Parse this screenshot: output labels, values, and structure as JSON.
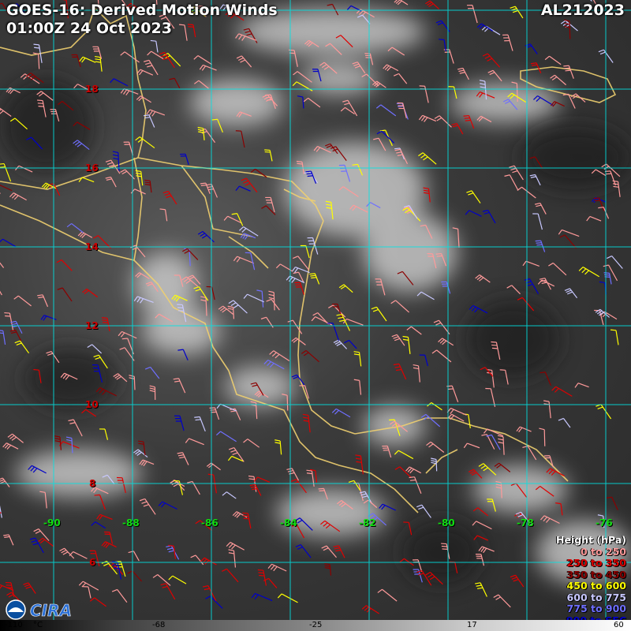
{
  "header": {
    "title_line1": "GOES-16: Derived Motion Winds",
    "title_line2": "01:00Z 24 Oct 2023",
    "storm_id": "AL212023"
  },
  "latitude_labels": [
    "18",
    "16",
    "14",
    "12",
    "10",
    "8",
    "6"
  ],
  "longitude_labels": [
    "-90",
    "-88",
    "-86",
    "-84",
    "-82",
    "-80",
    "-78",
    "-76"
  ],
  "legend": {
    "title": "Height (hPa)",
    "items": [
      {
        "label": "0 to 250",
        "color": "#ff9a9a"
      },
      {
        "label": "250 to 350",
        "color": "#e00000"
      },
      {
        "label": "350 to 450",
        "color": "#8b0000"
      },
      {
        "label": "450 to 600",
        "color": "#ffff00"
      },
      {
        "label": "600 to 775",
        "color": "#c8c8ff"
      },
      {
        "label": "775 to 900",
        "color": "#6f6fff"
      },
      {
        "label": "900 to SFC",
        "color": "#0000c8"
      }
    ]
  },
  "colorbar": {
    "labels": [
      "-110",
      "°C",
      "-68",
      "-25",
      "17",
      "60"
    ]
  },
  "colors": {
    "grid": "#00e5e5",
    "borders": "#f0d070",
    "lat_labels": "#cc0000",
    "lon_labels": "#11dd11"
  }
}
